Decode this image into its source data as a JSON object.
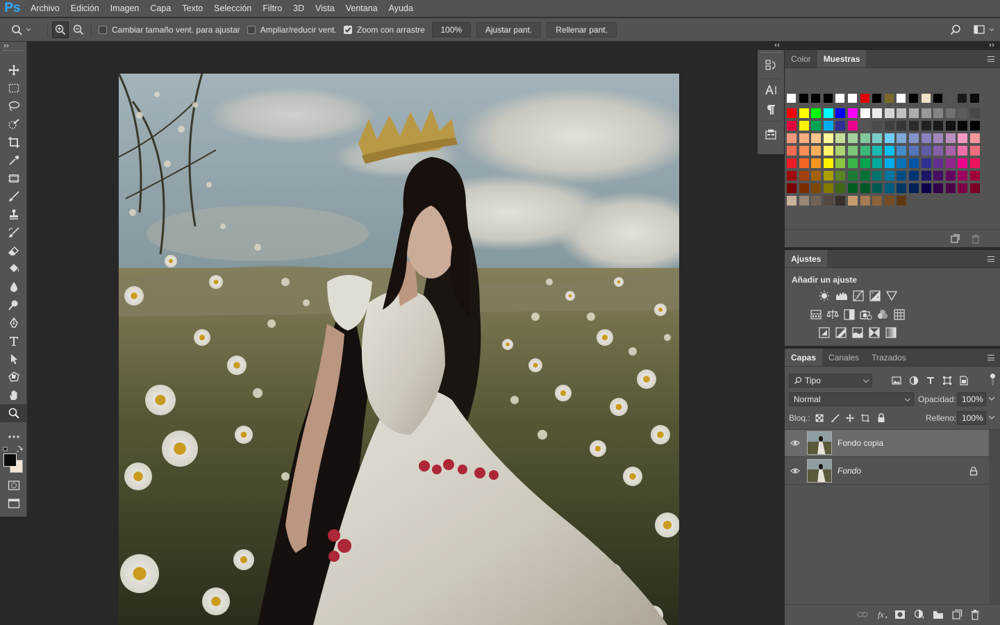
{
  "app": {
    "logo": "Ps"
  },
  "menu": [
    "Archivo",
    "Edición",
    "Imagen",
    "Capa",
    "Texto",
    "Selección",
    "Filtro",
    "3D",
    "Vista",
    "Ventana",
    "Ayuda"
  ],
  "options": {
    "resize_windows_label": "Cambiar tamaño vent. para ajustar",
    "resize_windows_checked": false,
    "zoom_all_label": "Ampliar/reducir vent.",
    "zoom_all_checked": false,
    "scrubby_zoom_label": "Zoom con arrastre",
    "scrubby_zoom_checked": true,
    "zoom_value": "100%",
    "fit_screen_label": "Ajustar pant.",
    "fill_screen_label": "Rellenar pant."
  },
  "toolbar": {
    "tools": [
      "move-tool-icon",
      "marquee-tool-icon",
      "lasso-tool-icon",
      "quick-select-tool-icon",
      "crop-tool-icon",
      "eyedropper-tool-icon",
      "frame-tool-icon",
      "brush-tool-icon",
      "stamp-tool-icon",
      "history-brush-icon",
      "eraser-tool-icon",
      "bucket-tool-icon",
      "blur-tool-icon",
      "dodge-tool-icon",
      "pen-tool-icon",
      "type-tool-icon",
      "path-select-tool-icon",
      "shape-tool-icon",
      "hand-tool-icon",
      "zoom-tool-icon",
      "more-tools-icon"
    ],
    "selected_tool": "zoom-tool-icon",
    "fg_color": "#0b0b0b",
    "bg_color": "#f3e3d3"
  },
  "panels": {
    "swatches": {
      "tabs": [
        "Color",
        "Muestras"
      ],
      "active_tab": "Muestras"
    },
    "adjustments": {
      "tab": "Ajustes",
      "title": "Añadir un ajuste"
    },
    "layers": {
      "tabs": [
        "Capas",
        "Canales",
        "Trazados"
      ],
      "active_tab": "Capas",
      "filter_label": "Tipo",
      "blend_mode": "Normal",
      "opacity_label": "Opacidad:",
      "opacity_value": "100%",
      "lock_label": "Bloq.:",
      "fill_label": "Relleno:",
      "fill_value": "100%",
      "items": [
        {
          "name": "Fondo copia",
          "selected": true,
          "locked": false
        },
        {
          "name": "Fondo",
          "selected": false,
          "locked": true
        }
      ]
    }
  }
}
